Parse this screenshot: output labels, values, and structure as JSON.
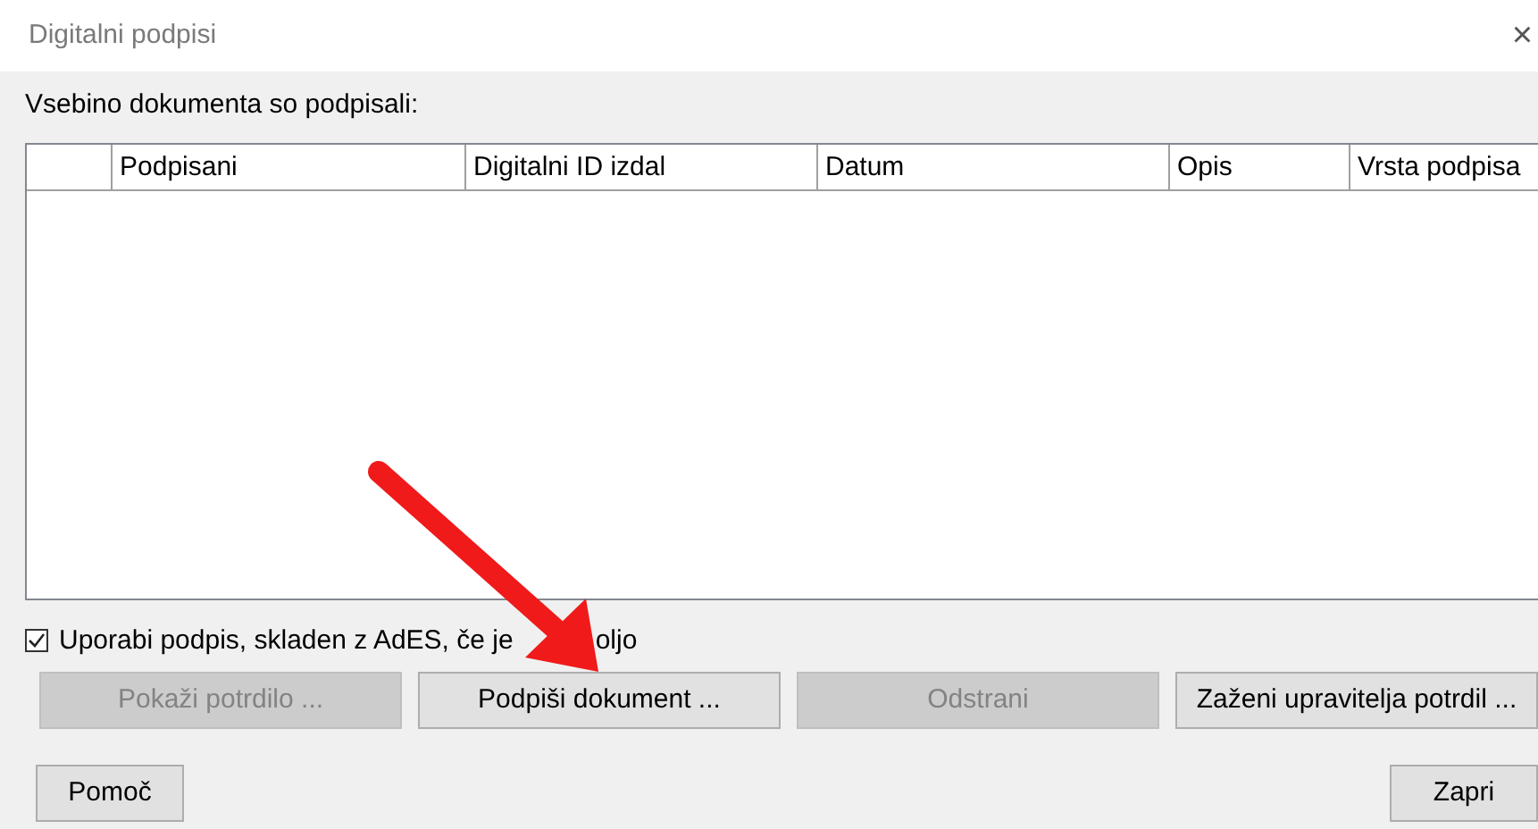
{
  "window": {
    "title": "Digitalni podpisi",
    "close": "×"
  },
  "heading": "Vsebino dokumenta so podpisali:",
  "table": {
    "columns": [
      "",
      "Podpisani",
      "Digitalni ID izdal",
      "Datum",
      "Opis",
      "Vrsta podpisa"
    ]
  },
  "checkbox": {
    "label": "Uporabi podpis, skladen z AdES, če je",
    "label_tail": "oljo",
    "checked": true
  },
  "buttons": [
    {
      "label": "Pokaži potrdilo ...",
      "disabled": true
    },
    {
      "label": "Podpiši dokument ...",
      "disabled": false
    },
    {
      "label": "Odstrani",
      "disabled": true
    },
    {
      "label": "Zaženi upravitelja potrdil ...",
      "disabled": false
    }
  ],
  "footer_buttons": [
    {
      "label": "Pomoč",
      "disabled": false
    },
    {
      "label": "Zapri",
      "disabled": false
    }
  ]
}
